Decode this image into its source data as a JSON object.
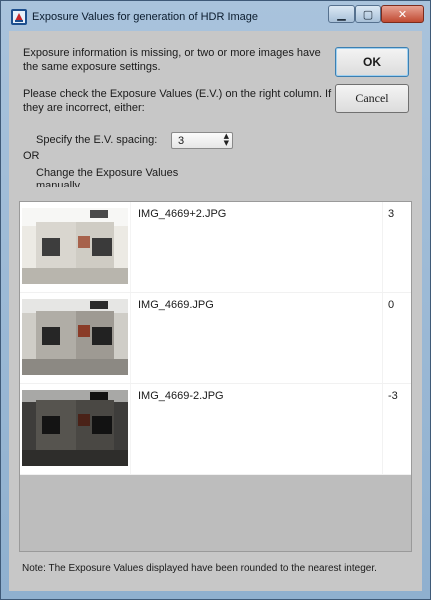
{
  "window": {
    "title": "Exposure Values for generation of HDR Image",
    "controls": {
      "minimize_icon": "minimize-icon",
      "maximize_icon": "maximize-icon",
      "close_icon": "close-icon"
    }
  },
  "message": {
    "line1": "Exposure information is missing, or two or more images have the same exposure settings.",
    "line2": "Please check the Exposure Values (E.V.) on the right column. If they are incorrect, either:"
  },
  "buttons": {
    "ok": "OK",
    "cancel": "Cancel"
  },
  "options": {
    "spacing_label": "Specify the E.V. spacing:",
    "spacing_value": "3",
    "or_label": "OR",
    "change_label": "Change the Exposure Values manually."
  },
  "images": [
    {
      "filename": "IMG_4669+2.JPG",
      "ev": "3",
      "brightness": "bright"
    },
    {
      "filename": "IMG_4669.JPG",
      "ev": "0",
      "brightness": "normal"
    },
    {
      "filename": "IMG_4669-2.JPG",
      "ev": "-3",
      "brightness": "dark"
    }
  ],
  "note": "Note: The Exposure Values displayed have been rounded to the nearest integer."
}
